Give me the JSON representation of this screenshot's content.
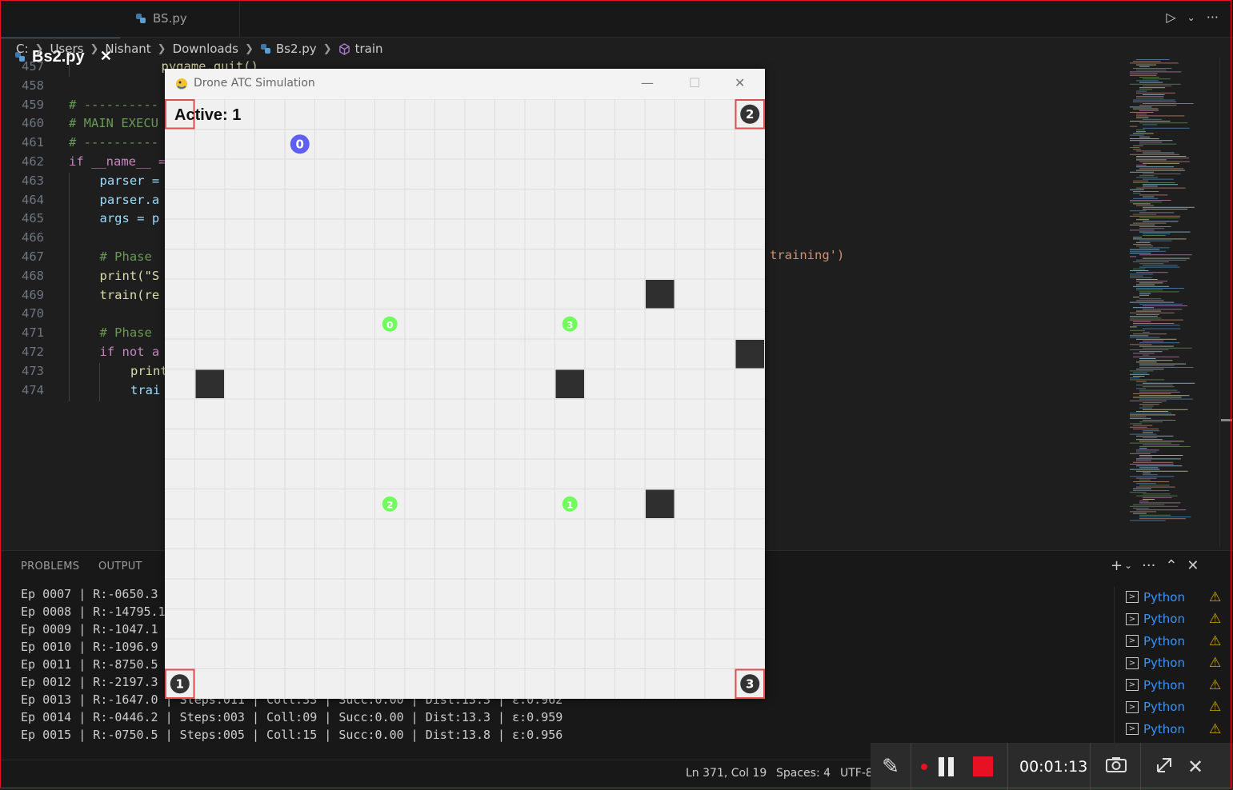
{
  "tabs": [
    {
      "label": "Bs2.py",
      "active": true
    },
    {
      "label": "BS.py",
      "active": false
    }
  ],
  "breadcrumb": [
    "C:",
    "Users",
    "Nishant",
    "Downloads",
    "Bs2.py",
    "train"
  ],
  "code_lines": [
    {
      "num": "457",
      "text": "pygame.quit()"
    },
    {
      "num": "458",
      "text": ""
    },
    {
      "num": "459",
      "text": "# ----------"
    },
    {
      "num": "460",
      "text": "# MAIN EXECU"
    },
    {
      "num": "461",
      "text": "# ----------"
    },
    {
      "num": "462",
      "text": "if __name__ ="
    },
    {
      "num": "463",
      "text": "parser ="
    },
    {
      "num": "464",
      "text": "parser.a"
    },
    {
      "num": "465",
      "text": "args = p"
    },
    {
      "num": "466",
      "text": ""
    },
    {
      "num": "467",
      "text": "# Phase"
    },
    {
      "num": "468",
      "text": "print(\"S"
    },
    {
      "num": "469",
      "text": "train(re"
    },
    {
      "num": "470",
      "text": ""
    },
    {
      "num": "471",
      "text": "# Phase"
    },
    {
      "num": "472",
      "text": "if not a"
    },
    {
      "num": "473",
      "text": "print"
    },
    {
      "num": "474",
      "text": "trai"
    }
  ],
  "code_tail": "training')",
  "panel": {
    "tabs": [
      "PROBLEMS",
      "OUTPUT"
    ],
    "terminal_lines": [
      "Ep 0007 | R:-0650.3",
      "Ep 0008 | R:-14795.1",
      "Ep 0009 | R:-1047.1",
      "Ep 0010 | R:-1096.9",
      "Ep 0011 | R:-8750.5",
      "Ep 0012 | R:-2197.3",
      "Ep 0013 | R:-1647.0 | Steps:011 | Coll:33 | Succ:0.00 | Dist:13.3 | ε:0.962",
      "Ep 0014 | R:-0446.2 | Steps:003 | Coll:09 | Succ:0.00 | Dist:13.3 | ε:0.959",
      "Ep 0015 | R:-0750.5 | Steps:005 | Coll:15 | Succ:0.00 | Dist:13.8 | ε:0.956"
    ],
    "terminals": [
      "Python",
      "Python",
      "Python",
      "Python",
      "Python",
      "Python",
      "Python"
    ]
  },
  "status": {
    "position": "Ln 371, Col 19",
    "spaces": "Spaces: 4",
    "encoding": "UTF-8"
  },
  "recorder": {
    "time": "00:01:13"
  },
  "pygame": {
    "title": "Drone ATC Simulation",
    "active_label": "Active: 1",
    "grid": {
      "cols": 20,
      "rows": 20
    },
    "obstacles": [
      [
        16,
        6
      ],
      [
        19,
        8
      ],
      [
        1,
        9
      ],
      [
        13,
        9
      ],
      [
        16,
        13
      ]
    ],
    "targets": [
      {
        "id": "0",
        "col": 7,
        "row": 7
      },
      {
        "id": "3",
        "col": 13,
        "row": 7
      },
      {
        "id": "2",
        "col": 7,
        "row": 13
      },
      {
        "id": "1",
        "col": 13,
        "row": 13
      }
    ],
    "drones": [
      {
        "id": "0",
        "col": 4,
        "row": 1
      }
    ],
    "pads": [
      {
        "id": "2",
        "corner": "top-right"
      },
      {
        "id": "1",
        "corner": "bottom-left"
      },
      {
        "id": "3",
        "corner": "bottom-right"
      }
    ],
    "colors": {
      "target": "#70ff5c",
      "drone": "#5f5ff5",
      "pad": "#333333",
      "obstacle": "#2f2f2f",
      "pad_border": "#e05050"
    }
  }
}
